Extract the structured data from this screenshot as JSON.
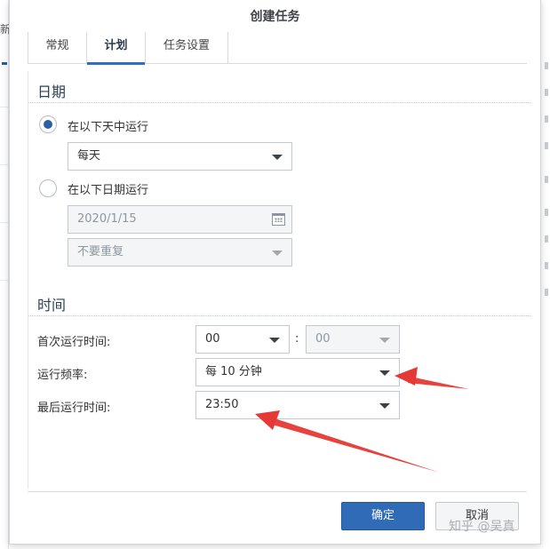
{
  "background": {
    "left_fragment": "新"
  },
  "dialog": {
    "title": "创建任务",
    "tabs": [
      {
        "label": "常规",
        "active": false
      },
      {
        "label": "计划",
        "active": true
      },
      {
        "label": "任务设置",
        "active": false
      }
    ],
    "date_section": {
      "title": "日期",
      "radio_daily_label": "在以下天中运行",
      "daily_select_value": "每天",
      "radio_date_label": "在以下日期运行",
      "date_value": "2020/1/15",
      "repeat_value": "不要重复"
    },
    "time_section": {
      "title": "时间",
      "first_run_label": "首次运行时间:",
      "first_run_hour": "00",
      "time_separator": ":",
      "first_run_minute": "00",
      "frequency_label": "运行频率:",
      "frequency_value": "每 10 分钟",
      "last_run_label": "最后运行时间:",
      "last_run_value": "23:50"
    },
    "buttons": {
      "ok": "确定",
      "cancel": "取消"
    }
  },
  "watermark": "知乎 @吴真",
  "colors": {
    "primary_button": "#2f6bb7",
    "annotation_arrow": "#e53935",
    "selected_radio": "#2d5fa3"
  }
}
